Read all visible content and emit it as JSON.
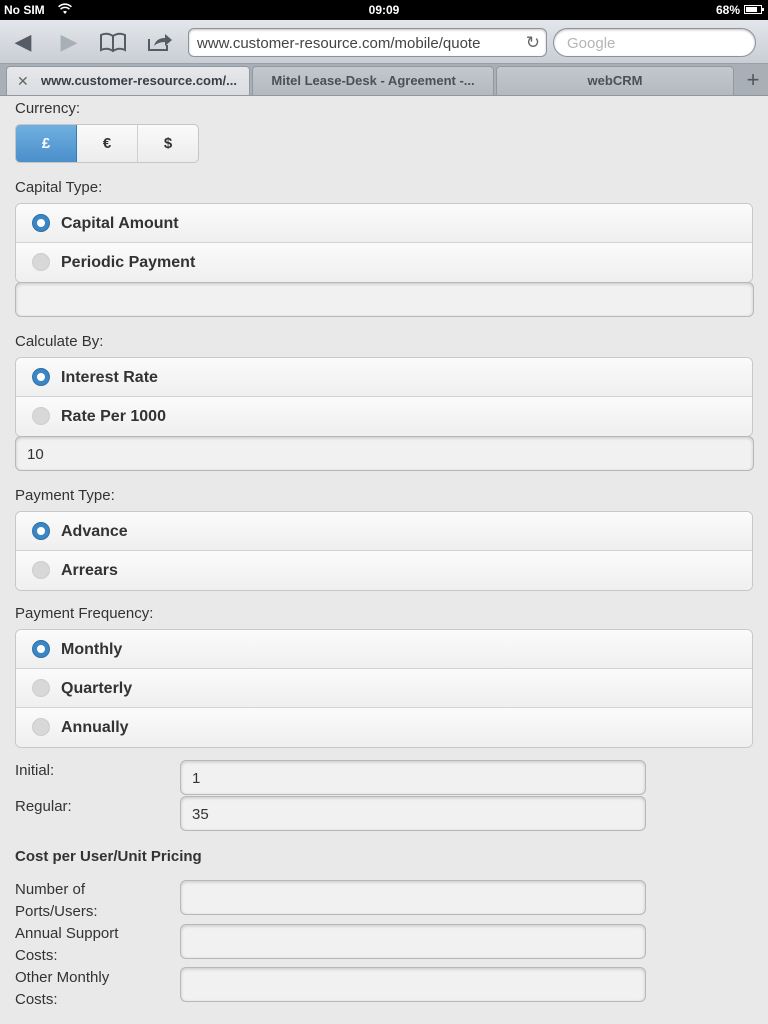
{
  "status": {
    "carrier": "No SIM",
    "time": "09:09",
    "battery": "68%"
  },
  "browser": {
    "url": "www.customer-resource.com/mobile/quote",
    "search_placeholder": "Google",
    "tabs": [
      {
        "label": "www.customer-resource.com/..."
      },
      {
        "label": "Mitel Lease-Desk - Agreement -..."
      },
      {
        "label": "webCRM"
      }
    ]
  },
  "form": {
    "currency": {
      "label": "Currency:",
      "options": [
        "£",
        "€",
        "$"
      ],
      "selected": "£"
    },
    "capital_type": {
      "label": "Capital Type:",
      "options": [
        "Capital Amount",
        "Periodic Payment"
      ],
      "selected": "Capital Amount",
      "value": ""
    },
    "calculate_by": {
      "label": "Calculate By:",
      "options": [
        "Interest Rate",
        "Rate Per 1000"
      ],
      "selected": "Interest Rate",
      "value": "10"
    },
    "payment_type": {
      "label": "Payment Type:",
      "options": [
        "Advance",
        "Arrears"
      ],
      "selected": "Advance"
    },
    "payment_frequency": {
      "label": "Payment Frequency:",
      "options": [
        "Monthly",
        "Quarterly",
        "Annually"
      ],
      "selected": "Monthly"
    },
    "initial": {
      "label": "Initial:",
      "value": "1"
    },
    "regular": {
      "label": "Regular:",
      "value": "35"
    },
    "cost_section": {
      "title": "Cost per User/Unit Pricing",
      "ports_label_1": "Number of",
      "ports_label_2": "Ports/Users:",
      "support_label_1": "Annual Support",
      "support_label_2": "Costs:",
      "other_label_1": "Other Monthly",
      "other_label_2": "Costs:"
    }
  }
}
